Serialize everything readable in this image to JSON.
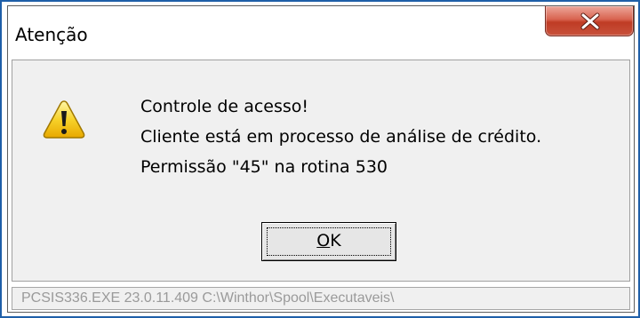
{
  "window": {
    "title": "Atenção",
    "close_icon": "close-icon"
  },
  "dialog": {
    "icon": "warning-icon",
    "lines": [
      "Controle de acesso!",
      "Cliente está em processo de análise de crédito.",
      "Permissão \"45\" na rotina 530"
    ],
    "ok_button": {
      "mnemonic": "O",
      "rest": "K"
    }
  },
  "status": {
    "text": "PCSIS336.EXE 23.0.11.409 C:\\Winthor\\Spool\\Executaveis\\"
  },
  "colors": {
    "close_button": "#c8523c",
    "frame_border": "#1f5fa8",
    "dialog_background": "#f0f0f0"
  }
}
